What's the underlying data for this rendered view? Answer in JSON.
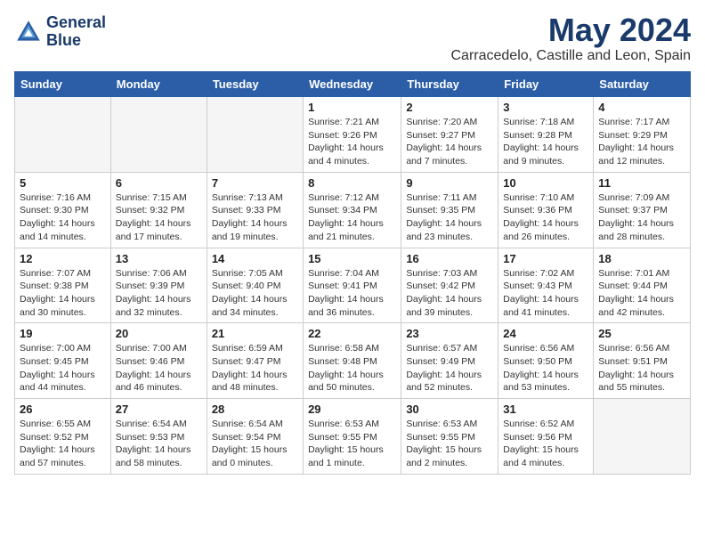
{
  "logo": {
    "line1": "General",
    "line2": "Blue"
  },
  "title": "May 2024",
  "location": "Carracedelo, Castille and Leon, Spain",
  "weekdays": [
    "Sunday",
    "Monday",
    "Tuesday",
    "Wednesday",
    "Thursday",
    "Friday",
    "Saturday"
  ],
  "weeks": [
    [
      {
        "day": "",
        "info": ""
      },
      {
        "day": "",
        "info": ""
      },
      {
        "day": "",
        "info": ""
      },
      {
        "day": "1",
        "info": "Sunrise: 7:21 AM\nSunset: 9:26 PM\nDaylight: 14 hours\nand 4 minutes."
      },
      {
        "day": "2",
        "info": "Sunrise: 7:20 AM\nSunset: 9:27 PM\nDaylight: 14 hours\nand 7 minutes."
      },
      {
        "day": "3",
        "info": "Sunrise: 7:18 AM\nSunset: 9:28 PM\nDaylight: 14 hours\nand 9 minutes."
      },
      {
        "day": "4",
        "info": "Sunrise: 7:17 AM\nSunset: 9:29 PM\nDaylight: 14 hours\nand 12 minutes."
      }
    ],
    [
      {
        "day": "5",
        "info": "Sunrise: 7:16 AM\nSunset: 9:30 PM\nDaylight: 14 hours\nand 14 minutes."
      },
      {
        "day": "6",
        "info": "Sunrise: 7:15 AM\nSunset: 9:32 PM\nDaylight: 14 hours\nand 17 minutes."
      },
      {
        "day": "7",
        "info": "Sunrise: 7:13 AM\nSunset: 9:33 PM\nDaylight: 14 hours\nand 19 minutes."
      },
      {
        "day": "8",
        "info": "Sunrise: 7:12 AM\nSunset: 9:34 PM\nDaylight: 14 hours\nand 21 minutes."
      },
      {
        "day": "9",
        "info": "Sunrise: 7:11 AM\nSunset: 9:35 PM\nDaylight: 14 hours\nand 23 minutes."
      },
      {
        "day": "10",
        "info": "Sunrise: 7:10 AM\nSunset: 9:36 PM\nDaylight: 14 hours\nand 26 minutes."
      },
      {
        "day": "11",
        "info": "Sunrise: 7:09 AM\nSunset: 9:37 PM\nDaylight: 14 hours\nand 28 minutes."
      }
    ],
    [
      {
        "day": "12",
        "info": "Sunrise: 7:07 AM\nSunset: 9:38 PM\nDaylight: 14 hours\nand 30 minutes."
      },
      {
        "day": "13",
        "info": "Sunrise: 7:06 AM\nSunset: 9:39 PM\nDaylight: 14 hours\nand 32 minutes."
      },
      {
        "day": "14",
        "info": "Sunrise: 7:05 AM\nSunset: 9:40 PM\nDaylight: 14 hours\nand 34 minutes."
      },
      {
        "day": "15",
        "info": "Sunrise: 7:04 AM\nSunset: 9:41 PM\nDaylight: 14 hours\nand 36 minutes."
      },
      {
        "day": "16",
        "info": "Sunrise: 7:03 AM\nSunset: 9:42 PM\nDaylight: 14 hours\nand 39 minutes."
      },
      {
        "day": "17",
        "info": "Sunrise: 7:02 AM\nSunset: 9:43 PM\nDaylight: 14 hours\nand 41 minutes."
      },
      {
        "day": "18",
        "info": "Sunrise: 7:01 AM\nSunset: 9:44 PM\nDaylight: 14 hours\nand 42 minutes."
      }
    ],
    [
      {
        "day": "19",
        "info": "Sunrise: 7:00 AM\nSunset: 9:45 PM\nDaylight: 14 hours\nand 44 minutes."
      },
      {
        "day": "20",
        "info": "Sunrise: 7:00 AM\nSunset: 9:46 PM\nDaylight: 14 hours\nand 46 minutes."
      },
      {
        "day": "21",
        "info": "Sunrise: 6:59 AM\nSunset: 9:47 PM\nDaylight: 14 hours\nand 48 minutes."
      },
      {
        "day": "22",
        "info": "Sunrise: 6:58 AM\nSunset: 9:48 PM\nDaylight: 14 hours\nand 50 minutes."
      },
      {
        "day": "23",
        "info": "Sunrise: 6:57 AM\nSunset: 9:49 PM\nDaylight: 14 hours\nand 52 minutes."
      },
      {
        "day": "24",
        "info": "Sunrise: 6:56 AM\nSunset: 9:50 PM\nDaylight: 14 hours\nand 53 minutes."
      },
      {
        "day": "25",
        "info": "Sunrise: 6:56 AM\nSunset: 9:51 PM\nDaylight: 14 hours\nand 55 minutes."
      }
    ],
    [
      {
        "day": "26",
        "info": "Sunrise: 6:55 AM\nSunset: 9:52 PM\nDaylight: 14 hours\nand 57 minutes."
      },
      {
        "day": "27",
        "info": "Sunrise: 6:54 AM\nSunset: 9:53 PM\nDaylight: 14 hours\nand 58 minutes."
      },
      {
        "day": "28",
        "info": "Sunrise: 6:54 AM\nSunset: 9:54 PM\nDaylight: 15 hours\nand 0 minutes."
      },
      {
        "day": "29",
        "info": "Sunrise: 6:53 AM\nSunset: 9:55 PM\nDaylight: 15 hours\nand 1 minute."
      },
      {
        "day": "30",
        "info": "Sunrise: 6:53 AM\nSunset: 9:55 PM\nDaylight: 15 hours\nand 2 minutes."
      },
      {
        "day": "31",
        "info": "Sunrise: 6:52 AM\nSunset: 9:56 PM\nDaylight: 15 hours\nand 4 minutes."
      },
      {
        "day": "",
        "info": ""
      }
    ]
  ]
}
